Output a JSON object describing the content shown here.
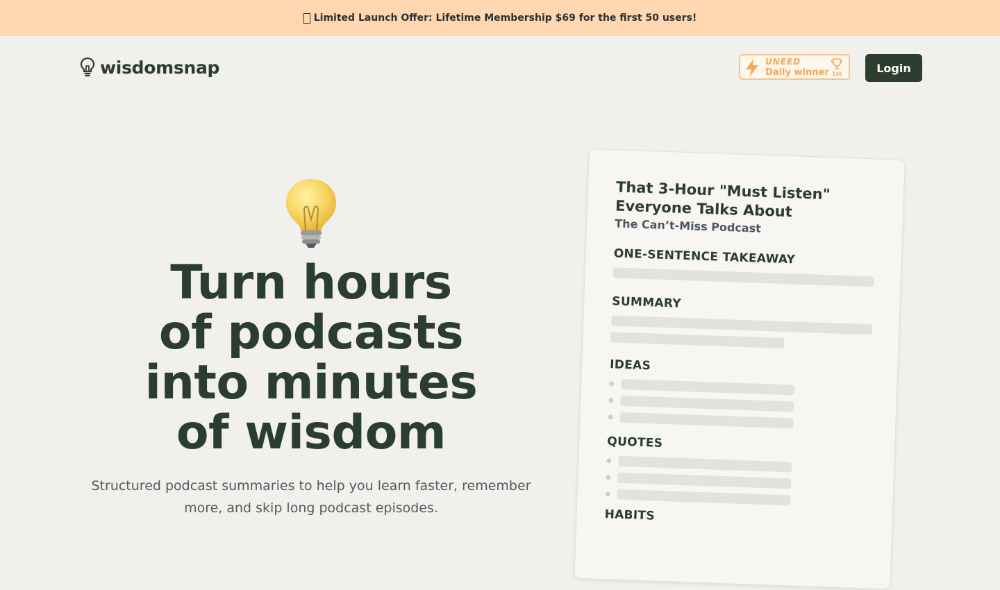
{
  "banner": {
    "text": "Limited Launch Offer: Lifetime Membership $69 for the first 50 users!"
  },
  "header": {
    "logo_text": "wisdomsnap",
    "badge": {
      "brand": "UNEED",
      "label": "Daily winner",
      "rank": "1st"
    },
    "login_label": "Login"
  },
  "hero": {
    "headline_lines": [
      "Turn hours",
      "of podcasts",
      "into minutes",
      "of wisdom"
    ],
    "subtitle": "Structured podcast summaries to help you learn faster, remember more, and skip long podcast episodes."
  },
  "preview": {
    "title": "That 3-Hour \"Must Listen\" Everyone Talks About",
    "podcast": "The Can’t-Miss Podcast",
    "sections": {
      "takeaway": "ONE-SENTENCE TAKEAWAY",
      "summary": "SUMMARY",
      "ideas": "IDEAS",
      "quotes": "QUOTES",
      "habits": "HABITS"
    }
  },
  "colors": {
    "banner_bg": "#ffd8b2",
    "primary": "#2c3e2d",
    "page_bg": "#f1f0ec",
    "badge_accent": "#f2a85c"
  }
}
